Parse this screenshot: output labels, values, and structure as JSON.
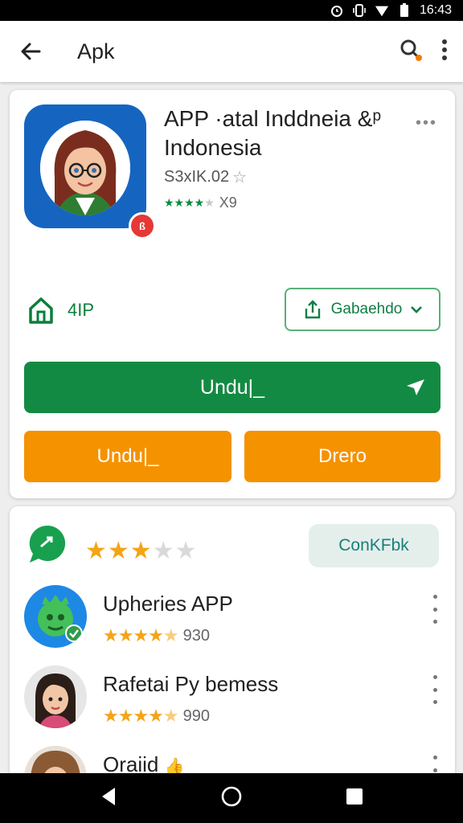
{
  "status_bar": {
    "time": "16:43",
    "icons": [
      "alarm-icon",
      "vibrate-icon",
      "wifi-icon",
      "battery-icon"
    ]
  },
  "app_bar": {
    "title": "Apk",
    "icons": [
      "back-arrow-icon",
      "search-icon",
      "more-vert-icon"
    ]
  },
  "app_detail": {
    "title": "APP ·atal Inddneia &ᵖ Indonesia",
    "developer": "S3xIK.02",
    "rating_count": "X9",
    "size": "4IP",
    "share_label": "Gabaehdo",
    "install_label": "Undu|_",
    "left_button_label": "Undu|_",
    "right_button_label": "Drero",
    "badge_text": "ß"
  },
  "reviews": {
    "stars_filled": 3,
    "stars_total": 5,
    "contact_label": "ConKFbk",
    "items": [
      {
        "name": "Upheries APP",
        "count": "930"
      },
      {
        "name": "Rafetai Py bemess",
        "count": "990"
      },
      {
        "name": "Oraiid"
      }
    ]
  },
  "colors": {
    "primary_green": "#138a43",
    "orange": "#f59200",
    "star": "#f4a416",
    "icon_blue": "#1565c0"
  }
}
